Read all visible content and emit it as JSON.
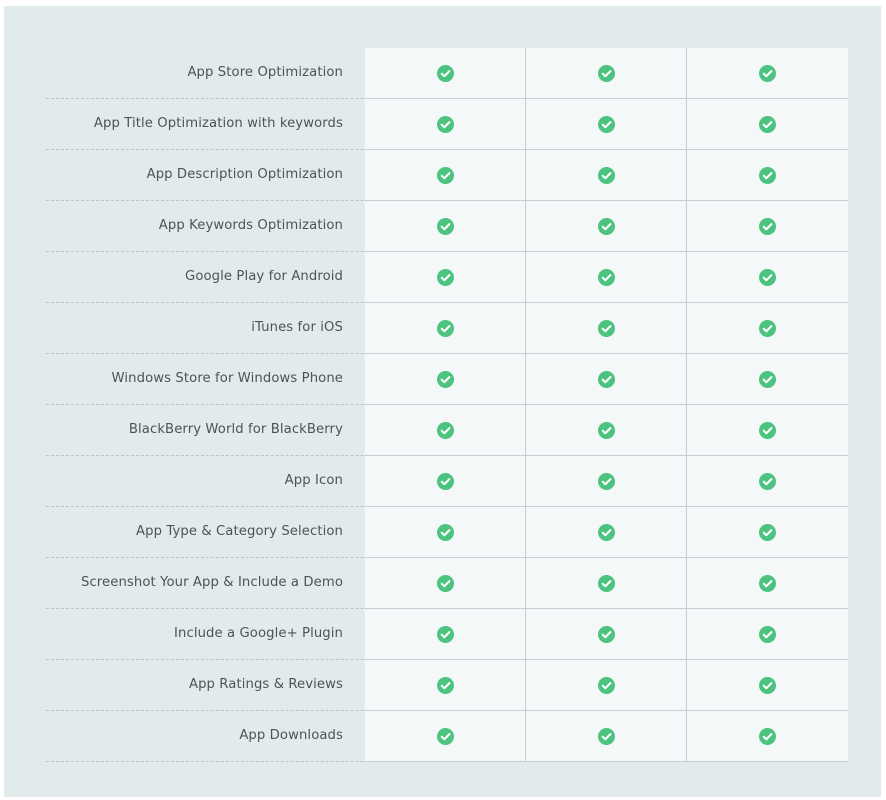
{
  "accent_color": "#4cc47f",
  "check_icon": "check-circle-icon",
  "features": [
    {
      "label": "App Store Optimization",
      "values": [
        true,
        true,
        true
      ]
    },
    {
      "label": "App Title Optimization with keywords",
      "values": [
        true,
        true,
        true
      ]
    },
    {
      "label": "App Description Optimization",
      "values": [
        true,
        true,
        true
      ]
    },
    {
      "label": "App Keywords Optimization",
      "values": [
        true,
        true,
        true
      ]
    },
    {
      "label": "Google Play for Android",
      "values": [
        true,
        true,
        true
      ]
    },
    {
      "label": "iTunes for iOS",
      "values": [
        true,
        true,
        true
      ]
    },
    {
      "label": "Windows Store for Windows Phone",
      "values": [
        true,
        true,
        true
      ]
    },
    {
      "label": "BlackBerry World for BlackBerry",
      "values": [
        true,
        true,
        true
      ]
    },
    {
      "label": "App Icon",
      "values": [
        true,
        true,
        true
      ]
    },
    {
      "label": "App Type & Category Selection",
      "values": [
        true,
        true,
        true
      ]
    },
    {
      "label": "Screenshot Your App & Include a Demo",
      "values": [
        true,
        true,
        true
      ]
    },
    {
      "label": "Include a Google+ Plugin",
      "values": [
        true,
        true,
        true
      ]
    },
    {
      "label": "App Ratings & Reviews",
      "values": [
        true,
        true,
        true
      ]
    },
    {
      "label": "App Downloads",
      "values": [
        true,
        true,
        true
      ]
    }
  ]
}
